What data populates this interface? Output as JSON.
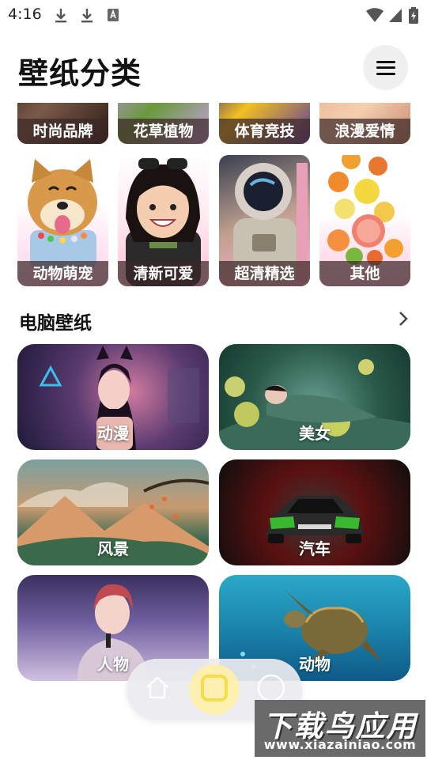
{
  "status_bar": {
    "time": "4:16"
  },
  "header": {
    "title": "壁纸分类"
  },
  "phone_categories": [
    {
      "label": "时尚品牌"
    },
    {
      "label": "花草植物"
    },
    {
      "label": "体育竞技"
    },
    {
      "label": "浪漫爱情"
    },
    {
      "label": "动物萌宠"
    },
    {
      "label": "清新可爱"
    },
    {
      "label": "超清精选"
    },
    {
      "label": "其他"
    }
  ],
  "pc_section": {
    "title": "电脑壁纸",
    "tiles": [
      {
        "label": "动漫"
      },
      {
        "label": "美女"
      },
      {
        "label": "风景"
      },
      {
        "label": "汽车"
      },
      {
        "label": "人物"
      },
      {
        "label": "动物"
      }
    ]
  },
  "bottom_nav": {
    "items": [
      {
        "icon": "home-icon"
      },
      {
        "icon": "square-icon"
      },
      {
        "icon": "circle-icon"
      }
    ],
    "active_index": 1
  },
  "watermark": {
    "title": "下载鸟应用",
    "url": "www.xiazainiao.com"
  },
  "colors": {
    "accent": "#f5dd4a",
    "label_overlay": "#3c2828"
  }
}
